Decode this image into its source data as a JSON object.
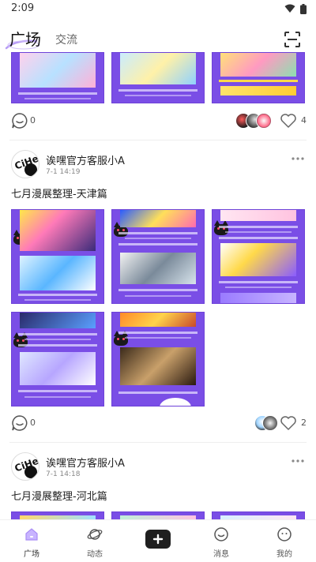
{
  "status_bar": {
    "time": "2:09"
  },
  "header": {
    "active_tab": "广场",
    "inactive_tab": "交流"
  },
  "posts": [
    {
      "comment_count": "0",
      "like_count": "4"
    },
    {
      "author": "诶嘿官方客服小A",
      "timestamp": "7-1 14:19",
      "title": "七月漫展整理-天津篇",
      "comment_count": "0",
      "like_count": "2"
    },
    {
      "author": "诶嘿官方客服小A",
      "timestamp": "7-1 14:18",
      "title": "七月漫展整理-河北篇"
    }
  ],
  "bottom_nav": {
    "items": [
      {
        "label": "广场",
        "icon": "home-icon"
      },
      {
        "label": "动态",
        "icon": "planet-icon"
      },
      {
        "label": "",
        "icon": "add-icon"
      },
      {
        "label": "消息",
        "icon": "message-icon"
      },
      {
        "label": "我的",
        "icon": "profile-icon"
      }
    ]
  },
  "colors": {
    "accent": "#7a4ee6",
    "avatar_logo_text": "CiHei"
  }
}
